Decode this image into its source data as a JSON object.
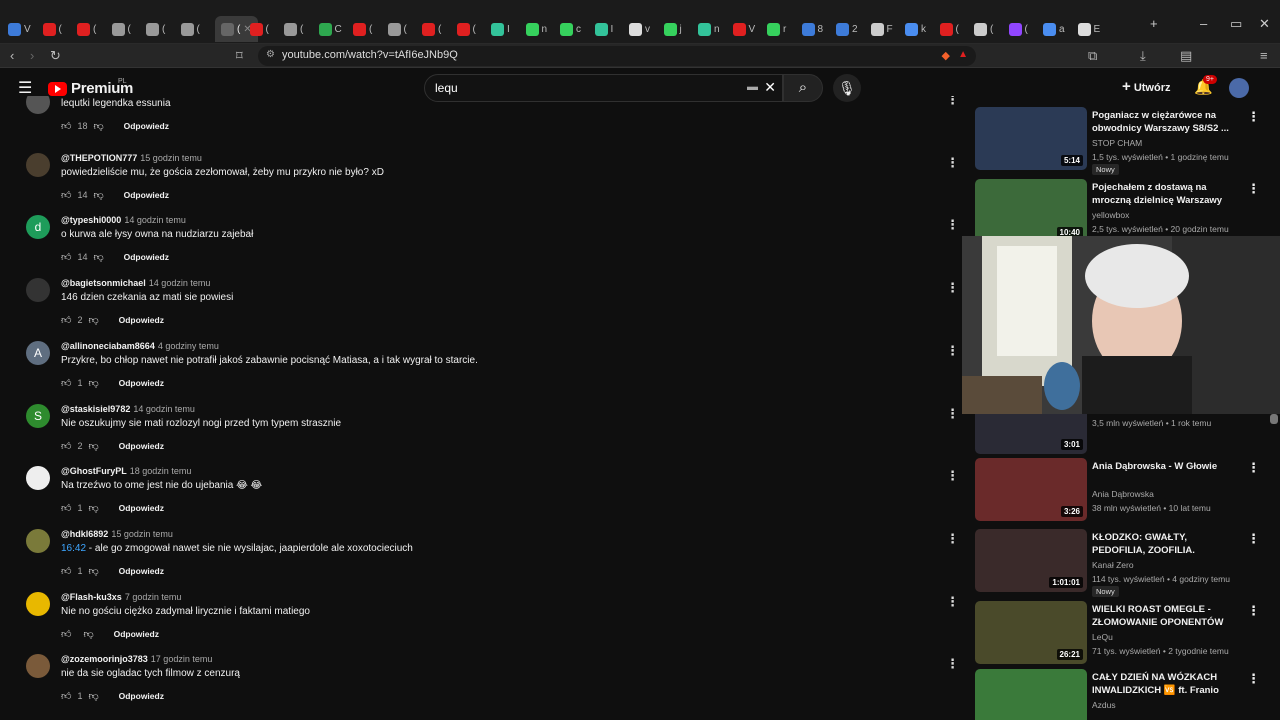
{
  "tabs": [
    {
      "label": "V",
      "color": "#3d7bd9"
    },
    {
      "label": "(",
      "color": "#e02020"
    },
    {
      "label": "(",
      "color": "#e02020"
    },
    {
      "label": "(",
      "color": "#999"
    },
    {
      "label": "(",
      "color": "#999"
    },
    {
      "label": "(",
      "color": "#999"
    },
    {
      "label": "(",
      "color": "#666"
    },
    {
      "label": "(",
      "color": "#e02020"
    },
    {
      "label": "(",
      "color": "#999"
    },
    {
      "label": "C",
      "color": "#2ea84f"
    },
    {
      "label": "(",
      "color": "#e02020"
    },
    {
      "label": "(",
      "color": "#999"
    },
    {
      "label": "(",
      "color": "#e02020"
    },
    {
      "label": "(",
      "color": "#e02020"
    },
    {
      "label": "I",
      "color": "#33c39a"
    },
    {
      "label": "n",
      "color": "#36d15d"
    },
    {
      "label": "c",
      "color": "#36d15d"
    },
    {
      "label": "I",
      "color": "#33c39a"
    },
    {
      "label": "v",
      "color": "#ddd"
    },
    {
      "label": "j",
      "color": "#36d15d"
    },
    {
      "label": "n",
      "color": "#33c39a"
    },
    {
      "label": "V",
      "color": "#e02020"
    },
    {
      "label": "r",
      "color": "#36d15d"
    },
    {
      "label": "8",
      "color": "#3d7bd9"
    },
    {
      "label": "2",
      "color": "#3d7bd9"
    },
    {
      "label": "F",
      "color": "#ccc"
    },
    {
      "label": "k",
      "color": "#4a8df0"
    },
    {
      "label": "(",
      "color": "#e02020"
    },
    {
      "label": "(",
      "color": "#ccc"
    },
    {
      "label": "(",
      "color": "#9146ff"
    },
    {
      "label": "a",
      "color": "#4a8df0"
    },
    {
      "label": "E",
      "color": "#ddd"
    }
  ],
  "address": {
    "url": "youtube.com/watch?v=tAfI6eJNb9Q"
  },
  "header": {
    "brand": "Premium",
    "region": "PL",
    "search_value": "lequ",
    "create_label": "Utwórz",
    "notif_count": "9+"
  },
  "reply_label": "Odpowiedz",
  "comments": [
    {
      "user": "",
      "time": "",
      "text": "lequtki legendka essunia",
      "likes": "18",
      "avatar_color": "#555",
      "avatar_letter": ""
    },
    {
      "user": "@THEPOTION777",
      "time": "15 godzin temu",
      "text": "powiedzieliście mu, że gościa zezłomował, żeby mu przykro nie było? xD",
      "likes": "14",
      "avatar_color": "#4a3e2e",
      "avatar_letter": ""
    },
    {
      "user": "@typeshi0000",
      "time": "14 godzin temu",
      "text": "o kurwa ale łysy owna na nudziarzu zajebał",
      "likes": "14",
      "avatar_color": "#1e9c5a",
      "avatar_letter": "d"
    },
    {
      "user": "@bagietsonmichael",
      "time": "14 godzin temu",
      "text": "146 dzien czekania az mati sie powiesi",
      "likes": "2",
      "avatar_color": "#333",
      "avatar_letter": ""
    },
    {
      "user": "@allinoneciabam8664",
      "time": "4 godziny temu",
      "text": "Przykre, bo chłop nawet nie potrafił jakoś zabawnie pocisnąć Matiasa, a i tak wygrał to starcie.",
      "likes": "1",
      "avatar_color": "#5f6e80",
      "avatar_letter": "A"
    },
    {
      "user": "@staskisiel9782",
      "time": "14 godzin temu",
      "text": "Nie oszukujmy sie mati rozlozyl nogi przed tym typem strasznie",
      "likes": "2",
      "avatar_color": "#2e8b2e",
      "avatar_letter": "S"
    },
    {
      "user": "@GhostFuryPL",
      "time": "18 godzin temu",
      "text": "Na trzeźwo to ome jest nie do ujebania 😂 😂",
      "likes": "1",
      "avatar_color": "#eee",
      "avatar_letter": ""
    },
    {
      "user": "@hdkl6892",
      "time": "15 godzin temu",
      "ts": "16:42",
      "text": " - ale go zmogował nawet sie nie wysilajac, jaapierdole ale xoxotocieciuch",
      "likes": "1",
      "avatar_color": "#7a7a3a",
      "avatar_letter": ""
    },
    {
      "user": "@Flash-ku3xs",
      "time": "7 godzin temu",
      "text": "Nie no gościu ciężko zadymał lirycznie i faktami matiego",
      "likes": "",
      "avatar_color": "#e8b800",
      "avatar_letter": ""
    },
    {
      "user": "@zozemoorinjo3783",
      "time": "17 godzin temu",
      "text": "nie da sie ogladac tych filmow z cenzurą",
      "likes": "1",
      "avatar_color": "#7a5a3a",
      "avatar_letter": ""
    }
  ],
  "videos": [
    {
      "title": "Poganiacz w ciężarówce na obwodnicy Warszawy S8/S2 ...",
      "channel": "STOP CHAM",
      "meta": "1,5 tys. wyświetleń • 1 godzinę temu",
      "badge": "Nowy",
      "duration": "5:14",
      "thumb": "#2b3a55"
    },
    {
      "title": "Pojechałem z dostawą na mroczną dzielnicę Warszawy",
      "channel": "yellowbox",
      "meta": "2,5 tys. wyświetleń • 20 godzin temu",
      "badge": "",
      "duration": "10:40",
      "thumb": "#3c6a3a"
    },
    {
      "title": "",
      "channel": "",
      "meta": "3,5 mln wyświetleń • 1 rok temu",
      "badge": "",
      "duration": "3:01",
      "thumb": "#2a2a35"
    },
    {
      "title": "Ania Dąbrowska - W Głowie",
      "channel": "Ania Dąbrowska",
      "meta": "38 mln wyświetleń • 10 lat temu",
      "badge": "",
      "duration": "3:26",
      "thumb": "#6a2a2a"
    },
    {
      "title": "KŁODZKO: GWAŁTY, PEDOFILIA, ZOOFILIA. WSTRZĄSAJĄCE ...",
      "channel": "Kanał Zero",
      "meta": "114 tys. wyświetleń • 4 godziny temu",
      "badge": "Nowy",
      "duration": "1:01:01",
      "thumb": "#3a2a2a"
    },
    {
      "title": "WIELKI ROAST OMEGLE - ZŁOMOWANIE OPONENTÓW ...",
      "channel": "LeQu",
      "meta": "71 tys. wyświetleń • 2 tygodnie temu",
      "badge": "",
      "duration": "26:21",
      "thumb": "#4a4a2a"
    },
    {
      "title": "CAŁY DZIEŃ NA WÓZKACH INWALIDZKICH 🆚 ft. Franio",
      "channel": "Azdus",
      "meta": "",
      "badge": "",
      "duration": "",
      "thumb": "#3a7a3a"
    }
  ]
}
